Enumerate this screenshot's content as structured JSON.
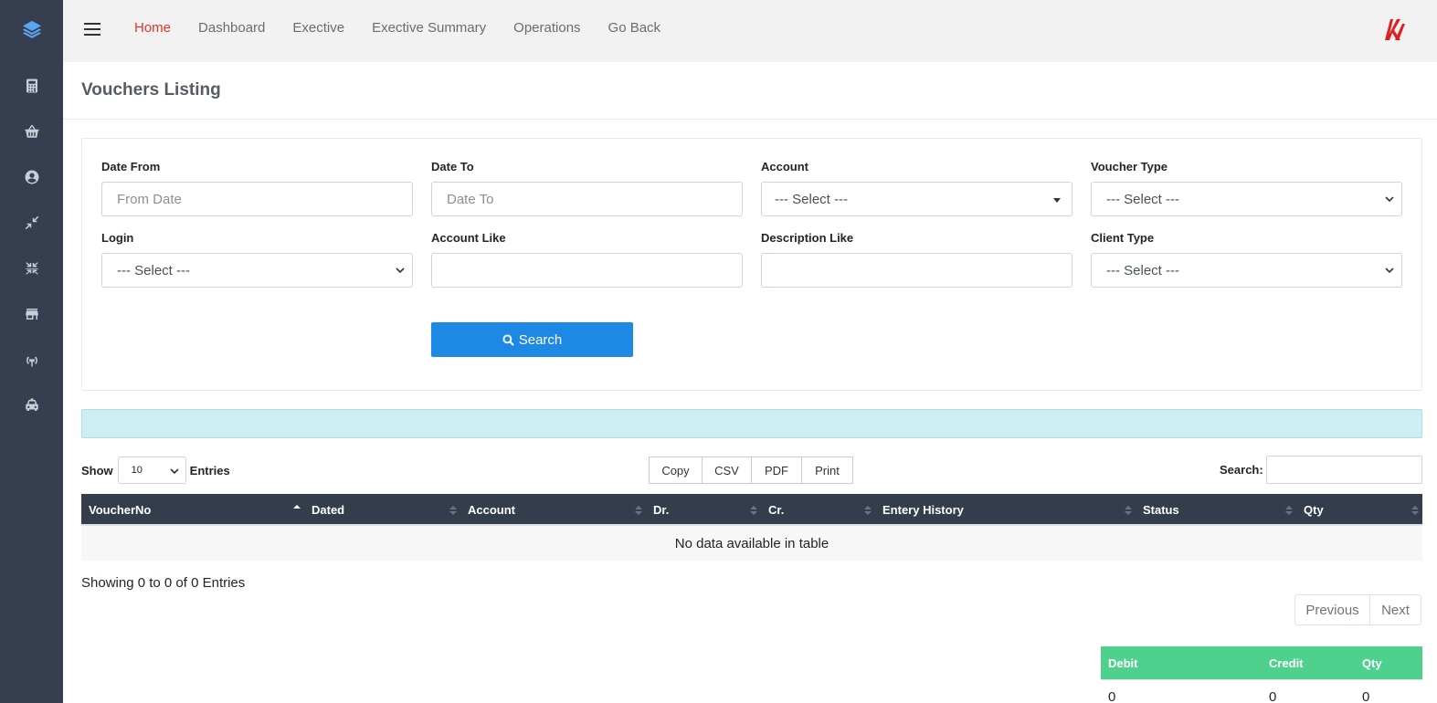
{
  "nav": {
    "links": [
      "Home",
      "Dashboard",
      "Exective",
      "Exective Summary",
      "Operations",
      "Go Back"
    ],
    "active": "Home"
  },
  "sidebar": {
    "icons": [
      "layers-icon",
      "calculator-icon",
      "basket-icon",
      "user-circle-icon",
      "compress-icon",
      "compress-alt-icon",
      "store-icon",
      "broadcast-icon",
      "taxi-icon"
    ]
  },
  "colors": {
    "sidebar_bg": "#353f4f",
    "active_link": "#e8322e",
    "primary_button": "#1e88e5",
    "table_head": "#333d4c",
    "totals_head": "#4fd18e",
    "info_bar": "#cdeff3"
  },
  "page": {
    "title": "Vouchers Listing"
  },
  "filters": {
    "date_from": {
      "label": "Date From",
      "placeholder": "From Date"
    },
    "date_to": {
      "label": "Date To",
      "placeholder": "Date To"
    },
    "account": {
      "label": "Account",
      "value": "--- Select ---"
    },
    "voucher_type": {
      "label": "Voucher Type",
      "value": "--- Select ---"
    },
    "login": {
      "label": "Login",
      "value": "--- Select ---"
    },
    "account_like": {
      "label": "Account Like",
      "value": ""
    },
    "description_like": {
      "label": "Description Like",
      "value": ""
    },
    "client_type": {
      "label": "Client Type",
      "value": "--- Select ---"
    },
    "search_button": "Search"
  },
  "table_controls": {
    "show_label": "Show",
    "entries_value": "10",
    "entries_label": "Entries",
    "export_buttons": [
      "Copy",
      "CSV",
      "PDF",
      "Print"
    ],
    "search_label": "Search:"
  },
  "table": {
    "columns": [
      "VoucherNo",
      "Dated",
      "Account",
      "Dr.",
      "Cr.",
      "Entery History",
      "Status",
      "Qty"
    ],
    "sorted_column": "VoucherNo",
    "empty_text": "No data available in table"
  },
  "footer": {
    "showing": "Showing 0 to 0 of 0 Entries",
    "previous": "Previous",
    "next": "Next"
  },
  "totals": {
    "columns": [
      "Debit",
      "Credit",
      "Qty"
    ],
    "values": [
      "0",
      "0",
      "0"
    ]
  }
}
